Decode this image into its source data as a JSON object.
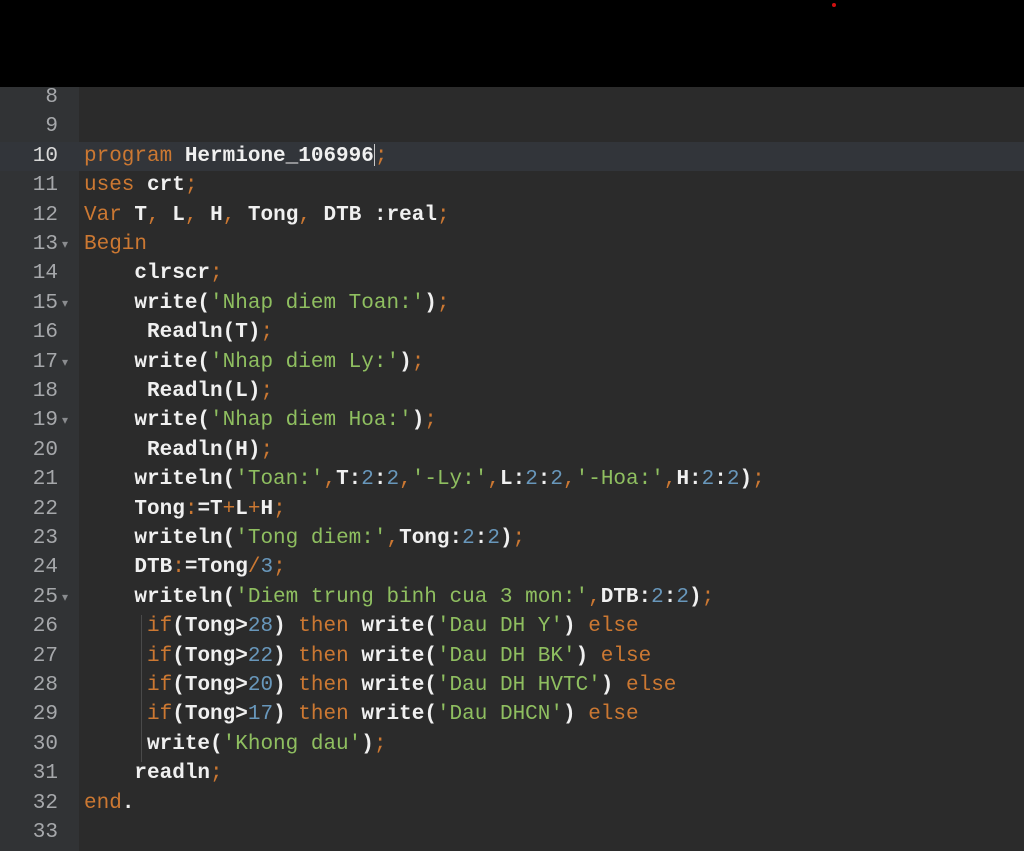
{
  "editor": {
    "current_line": 10,
    "lines": [
      {
        "n": "8",
        "fold": false,
        "tokens": []
      },
      {
        "n": "9",
        "fold": false,
        "tokens": []
      },
      {
        "n": "10",
        "fold": false,
        "tokens": [
          [
            "kw",
            "program"
          ],
          [
            "sp",
            " "
          ],
          [
            "id",
            "Hermione_106996"
          ],
          [
            "caret",
            ""
          ],
          [
            "op",
            ";"
          ]
        ]
      },
      {
        "n": "11",
        "fold": false,
        "tokens": [
          [
            "kw",
            "uses"
          ],
          [
            "sp",
            " "
          ],
          [
            "id",
            "crt"
          ],
          [
            "op",
            ";"
          ]
        ]
      },
      {
        "n": "12",
        "fold": false,
        "tokens": [
          [
            "kw",
            "Var"
          ],
          [
            "sp",
            " "
          ],
          [
            "id",
            "T"
          ],
          [
            "op",
            ","
          ],
          [
            "sp",
            " "
          ],
          [
            "id",
            "L"
          ],
          [
            "op",
            ","
          ],
          [
            "sp",
            " "
          ],
          [
            "id",
            "H"
          ],
          [
            "op",
            ","
          ],
          [
            "sp",
            " "
          ],
          [
            "id",
            "Tong"
          ],
          [
            "op",
            ","
          ],
          [
            "sp",
            " "
          ],
          [
            "id",
            "DTB"
          ],
          [
            "sp",
            " "
          ],
          [
            "id",
            ":real"
          ],
          [
            "op",
            ";"
          ]
        ]
      },
      {
        "n": "13",
        "fold": true,
        "tokens": [
          [
            "kw",
            "Begin"
          ]
        ]
      },
      {
        "n": "14",
        "fold": false,
        "tokens": [
          [
            "sp",
            "    "
          ],
          [
            "id",
            "clrscr"
          ],
          [
            "op",
            ";"
          ]
        ]
      },
      {
        "n": "15",
        "fold": true,
        "tokens": [
          [
            "sp",
            "    "
          ],
          [
            "id",
            "write("
          ],
          [
            "str",
            "'Nhap diem Toan:'"
          ],
          [
            "id",
            ")"
          ],
          [
            "op",
            ";"
          ]
        ]
      },
      {
        "n": "16",
        "fold": false,
        "tokens": [
          [
            "sp",
            "     "
          ],
          [
            "id",
            "Readln(T)"
          ],
          [
            "op",
            ";"
          ]
        ]
      },
      {
        "n": "17",
        "fold": true,
        "tokens": [
          [
            "sp",
            "    "
          ],
          [
            "id",
            "write("
          ],
          [
            "str",
            "'Nhap diem Ly:'"
          ],
          [
            "id",
            ")"
          ],
          [
            "op",
            ";"
          ]
        ]
      },
      {
        "n": "18",
        "fold": false,
        "tokens": [
          [
            "sp",
            "     "
          ],
          [
            "id",
            "Readln(L)"
          ],
          [
            "op",
            ";"
          ]
        ]
      },
      {
        "n": "19",
        "fold": true,
        "tokens": [
          [
            "sp",
            "    "
          ],
          [
            "id",
            "write("
          ],
          [
            "str",
            "'Nhap diem Hoa:'"
          ],
          [
            "id",
            ")"
          ],
          [
            "op",
            ";"
          ]
        ]
      },
      {
        "n": "20",
        "fold": false,
        "tokens": [
          [
            "sp",
            "     "
          ],
          [
            "id",
            "Readln(H)"
          ],
          [
            "op",
            ";"
          ]
        ]
      },
      {
        "n": "21",
        "fold": false,
        "tokens": [
          [
            "sp",
            "    "
          ],
          [
            "id",
            "writeln("
          ],
          [
            "str",
            "'Toan:'"
          ],
          [
            "op",
            ","
          ],
          [
            "id",
            "T:"
          ],
          [
            "num",
            "2"
          ],
          [
            "id",
            ":"
          ],
          [
            "num",
            "2"
          ],
          [
            "op",
            ","
          ],
          [
            "str",
            "'-Ly:'"
          ],
          [
            "op",
            ","
          ],
          [
            "id",
            "L:"
          ],
          [
            "num",
            "2"
          ],
          [
            "id",
            ":"
          ],
          [
            "num",
            "2"
          ],
          [
            "op",
            ","
          ],
          [
            "str",
            "'-Hoa:'"
          ],
          [
            "op",
            ","
          ],
          [
            "id",
            "H:"
          ],
          [
            "num",
            "2"
          ],
          [
            "id",
            ":"
          ],
          [
            "num",
            "2"
          ],
          [
            "id",
            ")"
          ],
          [
            "op",
            ";"
          ]
        ]
      },
      {
        "n": "22",
        "fold": false,
        "tokens": [
          [
            "sp",
            "    "
          ],
          [
            "id",
            "Tong"
          ],
          [
            "op",
            ":"
          ],
          [
            "id",
            "=T"
          ],
          [
            "op",
            "+"
          ],
          [
            "id",
            "L"
          ],
          [
            "op",
            "+"
          ],
          [
            "id",
            "H"
          ],
          [
            "op",
            ";"
          ]
        ]
      },
      {
        "n": "23",
        "fold": false,
        "tokens": [
          [
            "sp",
            "    "
          ],
          [
            "id",
            "writeln("
          ],
          [
            "str",
            "'Tong diem:'"
          ],
          [
            "op",
            ","
          ],
          [
            "id",
            "Tong:"
          ],
          [
            "num",
            "2"
          ],
          [
            "id",
            ":"
          ],
          [
            "num",
            "2"
          ],
          [
            "id",
            ")"
          ],
          [
            "op",
            ";"
          ]
        ]
      },
      {
        "n": "24",
        "fold": false,
        "tokens": [
          [
            "sp",
            "    "
          ],
          [
            "id",
            "DTB"
          ],
          [
            "op",
            ":"
          ],
          [
            "id",
            "=Tong"
          ],
          [
            "op",
            "/"
          ],
          [
            "num",
            "3"
          ],
          [
            "op",
            ";"
          ]
        ]
      },
      {
        "n": "25",
        "fold": true,
        "tokens": [
          [
            "sp",
            "    "
          ],
          [
            "id",
            "writeln("
          ],
          [
            "str",
            "'Diem trung binh cua 3 mon:'"
          ],
          [
            "op",
            ","
          ],
          [
            "id",
            "DTB:"
          ],
          [
            "num",
            "2"
          ],
          [
            "id",
            ":"
          ],
          [
            "num",
            "2"
          ],
          [
            "id",
            ")"
          ],
          [
            "op",
            ";"
          ]
        ]
      },
      {
        "n": "26",
        "fold": false,
        "tokens": [
          [
            "sp",
            "     "
          ],
          [
            "kw",
            "if"
          ],
          [
            "id",
            "(Tong>"
          ],
          [
            "num",
            "28"
          ],
          [
            "id",
            ")"
          ],
          [
            "sp",
            " "
          ],
          [
            "kw",
            "then"
          ],
          [
            "sp",
            " "
          ],
          [
            "id",
            "write("
          ],
          [
            "str",
            "'Dau DH Y'"
          ],
          [
            "id",
            ")"
          ],
          [
            "sp",
            " "
          ],
          [
            "kw",
            "else"
          ]
        ]
      },
      {
        "n": "27",
        "fold": false,
        "tokens": [
          [
            "sp",
            "     "
          ],
          [
            "kw",
            "if"
          ],
          [
            "id",
            "(Tong>"
          ],
          [
            "num",
            "22"
          ],
          [
            "id",
            ")"
          ],
          [
            "sp",
            " "
          ],
          [
            "kw",
            "then"
          ],
          [
            "sp",
            " "
          ],
          [
            "id",
            "write("
          ],
          [
            "str",
            "'Dau DH BK'"
          ],
          [
            "id",
            ")"
          ],
          [
            "sp",
            " "
          ],
          [
            "kw",
            "else"
          ]
        ]
      },
      {
        "n": "28",
        "fold": false,
        "tokens": [
          [
            "sp",
            "     "
          ],
          [
            "kw",
            "if"
          ],
          [
            "id",
            "(Tong>"
          ],
          [
            "num",
            "20"
          ],
          [
            "id",
            ")"
          ],
          [
            "sp",
            " "
          ],
          [
            "kw",
            "then"
          ],
          [
            "sp",
            " "
          ],
          [
            "id",
            "write("
          ],
          [
            "str",
            "'Dau DH HVTC'"
          ],
          [
            "id",
            ")"
          ],
          [
            "sp",
            " "
          ],
          [
            "kw",
            "else"
          ]
        ]
      },
      {
        "n": "29",
        "fold": false,
        "tokens": [
          [
            "sp",
            "     "
          ],
          [
            "kw",
            "if"
          ],
          [
            "id",
            "(Tong>"
          ],
          [
            "num",
            "17"
          ],
          [
            "id",
            ")"
          ],
          [
            "sp",
            " "
          ],
          [
            "kw",
            "then"
          ],
          [
            "sp",
            " "
          ],
          [
            "id",
            "write("
          ],
          [
            "str",
            "'Dau DHCN'"
          ],
          [
            "id",
            ")"
          ],
          [
            "sp",
            " "
          ],
          [
            "kw",
            "else"
          ]
        ]
      },
      {
        "n": "30",
        "fold": false,
        "tokens": [
          [
            "sp",
            "     "
          ],
          [
            "id",
            "write("
          ],
          [
            "str",
            "'Khong dau'"
          ],
          [
            "id",
            ")"
          ],
          [
            "op",
            ";"
          ]
        ]
      },
      {
        "n": "31",
        "fold": false,
        "tokens": [
          [
            "sp",
            "    "
          ],
          [
            "id",
            "readln"
          ],
          [
            "op",
            ";"
          ]
        ]
      },
      {
        "n": "32",
        "fold": false,
        "tokens": [
          [
            "kw",
            "end"
          ],
          [
            "id",
            "."
          ]
        ]
      },
      {
        "n": "33",
        "fold": false,
        "tokens": []
      }
    ]
  }
}
